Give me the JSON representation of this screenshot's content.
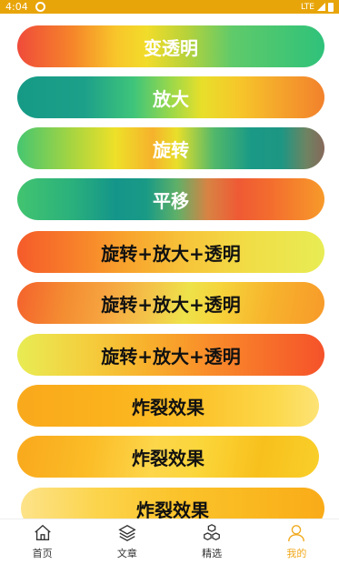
{
  "status_bar": {
    "time": "4:04",
    "network": "LTE"
  },
  "buttons": [
    {
      "label": "变透明"
    },
    {
      "label": "放大"
    },
    {
      "label": "旋转"
    },
    {
      "label": "平移"
    },
    {
      "label": "旋转+放大+透明"
    },
    {
      "label": "旋转+放大+透明"
    },
    {
      "label": "旋转+放大+透明"
    },
    {
      "label": "炸裂效果"
    },
    {
      "label": "炸裂效果"
    },
    {
      "label": "炸裂效果"
    }
  ],
  "bottom_nav": {
    "items": [
      {
        "label": "首页",
        "icon": "home-icon"
      },
      {
        "label": "文章",
        "icon": "layers-icon"
      },
      {
        "label": "精选",
        "icon": "cubes-icon"
      },
      {
        "label": "我的",
        "icon": "user-icon"
      }
    ],
    "active_index": 3,
    "active_color": "#f0a81a"
  },
  "colors": {
    "status_bar": "#e8a50a"
  }
}
